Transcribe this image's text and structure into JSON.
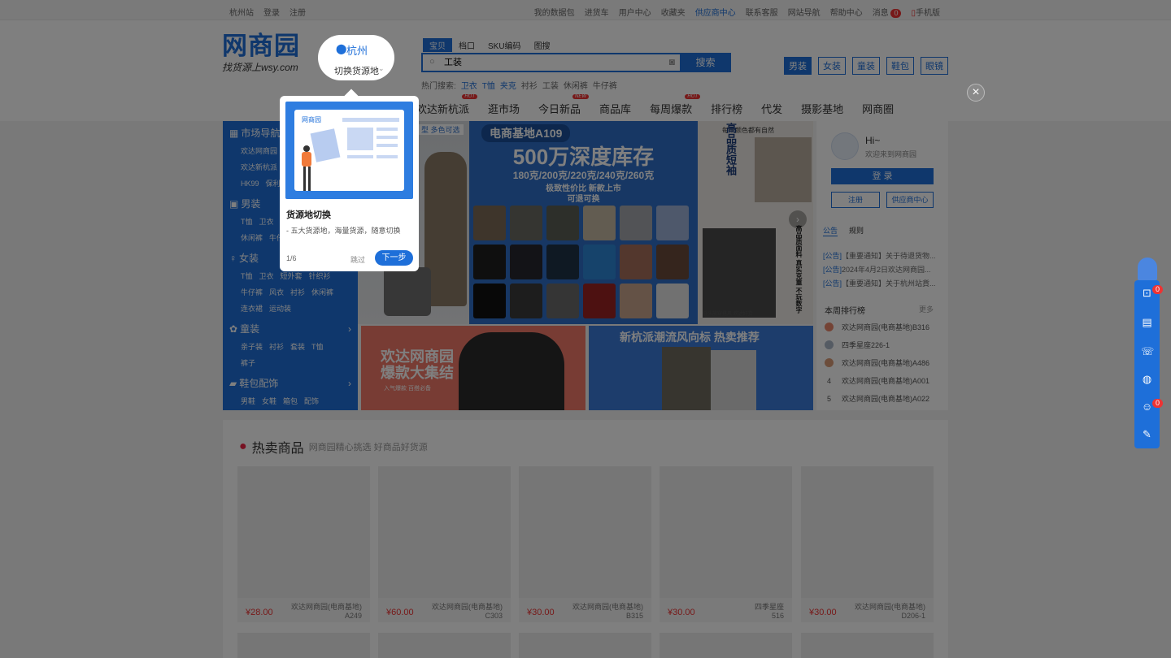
{
  "topbar": {
    "left": [
      "杭州站",
      "登录",
      "注册"
    ],
    "right": [
      "我的数据包",
      "进货车",
      "用户中心",
      "收藏夹",
      "供应商中心",
      "联系客服",
      "网站导航",
      "帮助中心",
      "消息",
      "手机版"
    ],
    "message_count": "0"
  },
  "logo": {
    "main": "网商园",
    "slogan": "找货源上wsy.com"
  },
  "location": {
    "city": "杭州",
    "switch_label": "切换货源地"
  },
  "search": {
    "tabs": [
      "宝贝",
      "档口",
      "SKU编码",
      "图搜"
    ],
    "value": "工装",
    "button": "搜索",
    "hot_label": "热门搜索:",
    "hot_terms": [
      "卫衣",
      "T恤",
      "夹克",
      "衬衫",
      "工装",
      "休闲裤",
      "牛仔裤"
    ]
  },
  "category_buttons": [
    "男装",
    "女装",
    "童装",
    "鞋包",
    "眼镜"
  ],
  "nav": [
    "欢达新杭派",
    "逛市场",
    "今日新品",
    "商品库",
    "每周爆款",
    "排行榜",
    "代发",
    "摄影基地",
    "网商圈"
  ],
  "nav_badges": {
    "hot": "HOT",
    "new": "NEW"
  },
  "leftnav": {
    "market": {
      "title": "市场导航",
      "items": [
        "欢达网商园",
        "欢达新杭派",
        "HK99",
        "保利"
      ]
    },
    "men": {
      "title": "男装",
      "items": [
        "T恤",
        "卫衣",
        "休闲裤",
        "牛仔裤"
      ]
    },
    "women": {
      "title": "女装",
      "rows": [
        [
          "T恤",
          "卫衣",
          "短外套",
          "针织衫"
        ],
        [
          "牛仔裤",
          "风衣",
          "衬衫",
          "休闲裤"
        ],
        [
          "连衣裙",
          "运动装"
        ]
      ]
    },
    "kids": {
      "title": "童装",
      "rows": [
        [
          "亲子装",
          "衬衫",
          "套装",
          "T恤"
        ],
        [
          "裤子"
        ]
      ]
    },
    "bags": {
      "title": "鞋包配饰",
      "items": [
        "男鞋",
        "女鞋",
        "箱包",
        "配饰"
      ]
    }
  },
  "banner": {
    "tag": "型 多色可选",
    "title": "电商基地A109",
    "headline": "500万深度库存",
    "weights": "180克/200克/220克/240克/260克",
    "line1": "极致性价比 新款上市",
    "line2": "可退可换",
    "right_top": "每个颜色都有自然",
    "right_vert": "高品质短袖",
    "right_vert2": "高品质面料 真实克重 不玩数字",
    "right_foot": "低头族穿搭风 欢达好货"
  },
  "promo": {
    "left_title1": "欢达网商园",
    "left_title2": "爆款大集结",
    "left_sub": "入气爆款 百搭必备",
    "right_title": "新杭派潮流风向标 热卖推荐"
  },
  "user": {
    "greeting": "Hi~",
    "welcome": "欢迎来到网商园",
    "login": "登 录",
    "register": "注册",
    "supplier": "供应商中心",
    "tabs": [
      "公告",
      "规则"
    ],
    "announcements": [
      {
        "tag": "[公告]",
        "text": "【重要通知】关于待退货物..."
      },
      {
        "tag": "[公告]",
        "text": "2024年4月2日欢达网商园..."
      },
      {
        "tag": "[公告]",
        "text": "【重要通知】关于杭州站貨..."
      }
    ],
    "rank_title": "本周排行榜",
    "rank_more": "更多",
    "rank": [
      {
        "no": "1",
        "name": "欢达网商园(电商基地)B316"
      },
      {
        "no": "2",
        "name": "四季星座226-1"
      },
      {
        "no": "3",
        "name": "欢达网商园(电商基地)A486"
      },
      {
        "no": "4",
        "name": "欢达网商园(电商基地)A001"
      },
      {
        "no": "5",
        "name": "欢达网商园(电商基地)A022"
      }
    ]
  },
  "hot": {
    "title": "热卖商品",
    "subtitle": "网商园精心挑选 好商品好货源",
    "products": [
      {
        "price": "¥28.00",
        "shop": "欢达网商园(电商基地)",
        "code": "A249"
      },
      {
        "price": "¥60.00",
        "shop": "欢达网商园(电商基地)",
        "code": "C303"
      },
      {
        "price": "¥30.00",
        "shop": "欢达网商园(电商基地)",
        "code": "B315"
      },
      {
        "price": "¥30.00",
        "shop": "四季星座",
        "code": "516"
      },
      {
        "price": "¥30.00",
        "shop": "欢达网商园(电商基地)",
        "code": "D206-1"
      }
    ]
  },
  "guide": {
    "image_brand": "网商园",
    "title": "货源地切换",
    "desc": "- 五大货源地，海量货源，随意切换",
    "step": "1/6",
    "skip": "跳过",
    "next": "下一步"
  },
  "floatbar_badges": [
    "0",
    "0"
  ],
  "colors": {
    "brand": "#1e6fd9",
    "hot": "#ee3333",
    "overlay": "rgba(0,0,0,0.5)"
  }
}
